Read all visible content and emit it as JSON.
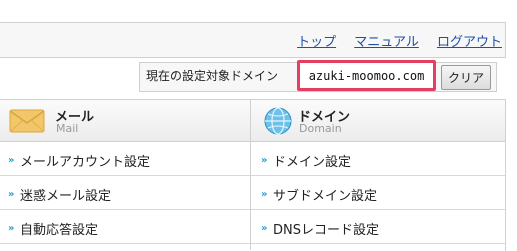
{
  "nav": {
    "links": [
      "トップ",
      "マニュアル",
      "ログアウト"
    ]
  },
  "domain_bar": {
    "label": "現在の設定対象ドメイン",
    "value": "azuki-moomoo.com",
    "clear_button": "クリア"
  },
  "sections": {
    "mail": {
      "title": "メール",
      "subtitle": "Mail"
    },
    "domain": {
      "title": "ドメイン",
      "subtitle": "Domain"
    }
  },
  "menu": {
    "mail_items": [
      "メールアカウント設定",
      "迷惑メール設定",
      "自動応答設定"
    ],
    "domain_items": [
      "ドメイン設定",
      "サブドメイン設定",
      "DNSレコード設定"
    ]
  },
  "colors": {
    "highlight": "#e63e63",
    "link": "#1f4fa8",
    "arrow": "#1a9bd7"
  }
}
